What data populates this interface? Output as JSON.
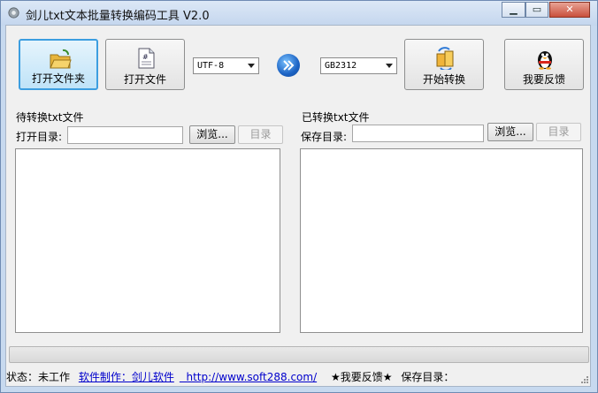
{
  "window": {
    "title": "剑儿txt文本批量转换编码工具 V2.0",
    "controls": {
      "minimize": "▁",
      "maximize": "▭",
      "close": "✕"
    }
  },
  "toolbar": {
    "open_folder": "打开文件夹",
    "open_file": "打开文件",
    "source_encoding": "UTF-8",
    "target_encoding": "GB2312",
    "start_convert": "开始转换",
    "feedback": "我要反馈"
  },
  "left_panel": {
    "group_title": "待转换txt文件",
    "dir_label": "打开目录:",
    "dir_value": "",
    "browse": "浏览...",
    "directory": "目录"
  },
  "right_panel": {
    "group_title": "已转换txt文件",
    "dir_label": "保存目录:",
    "dir_value": "",
    "browse": "浏览...",
    "directory": "目录"
  },
  "progress": {
    "value": 0
  },
  "status": {
    "state": "状态：未工作",
    "credit": "软件制作：剑儿软件",
    "url": "http://www.soft288.com/",
    "feedback": "★我要反馈★",
    "save_dir": "保存目录："
  },
  "icons": {
    "app": "gear-icon",
    "folder": "folder-open-icon",
    "file": "document-icon",
    "arrow": "double-chevron-icon",
    "convert": "convert-icon",
    "feedback": "penguin-icon"
  }
}
